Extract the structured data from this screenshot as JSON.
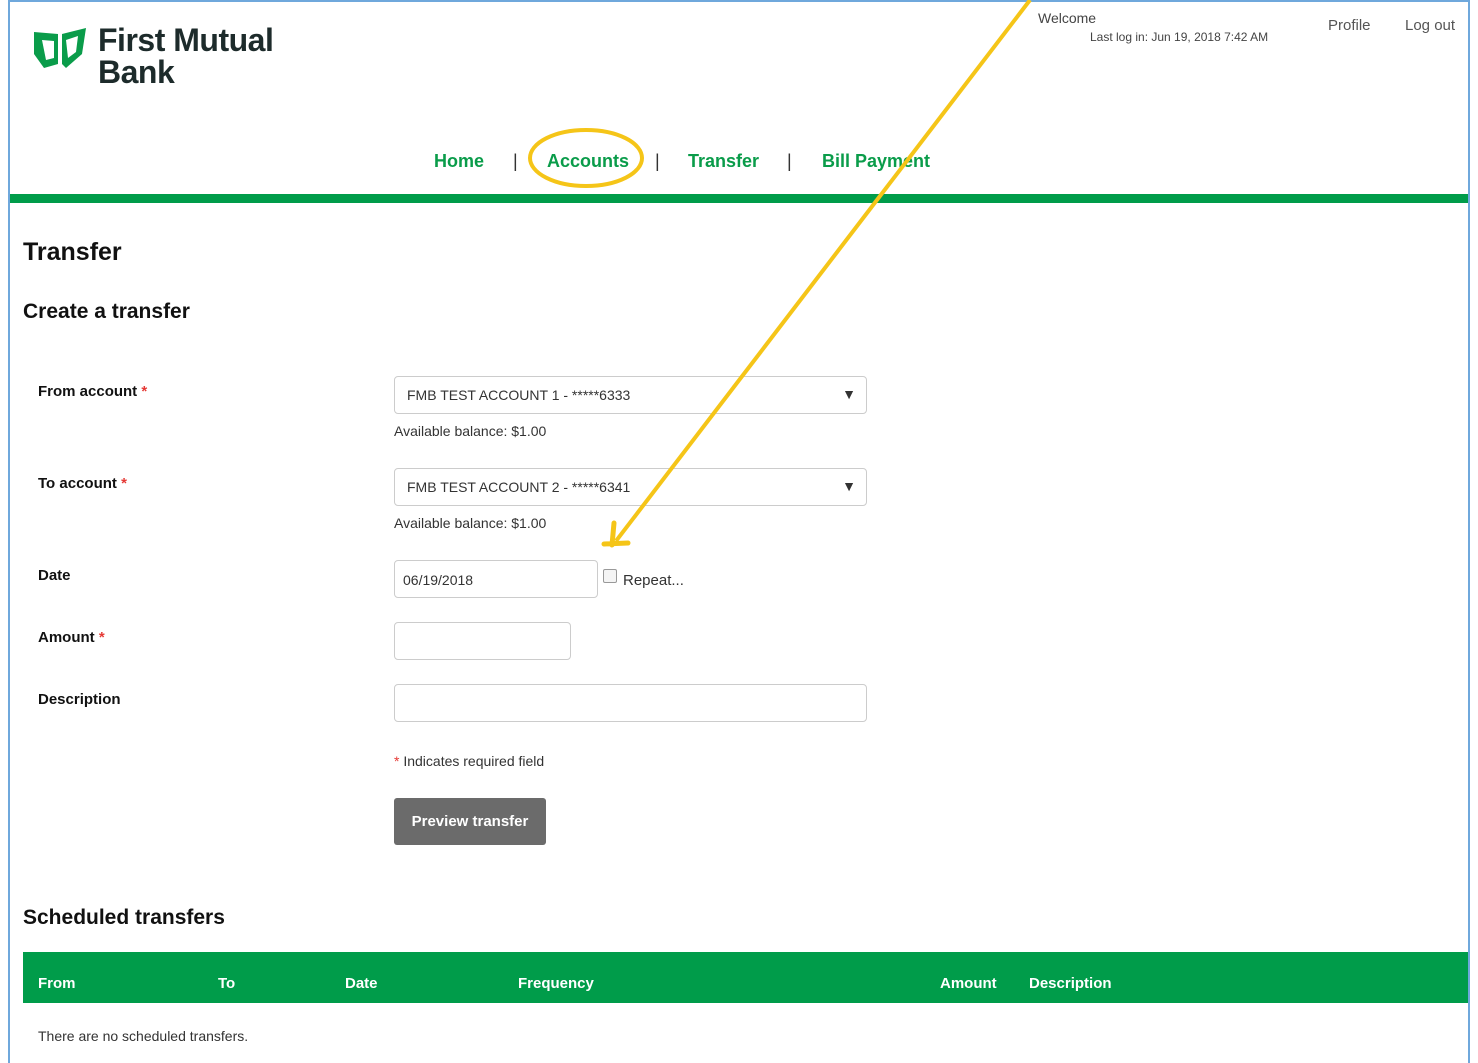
{
  "brand": {
    "name_line1": "First Mutual",
    "name_line2": "Bank",
    "logo_color": "#0a9c4a"
  },
  "header": {
    "welcome": "Welcome",
    "last_login": "Last log in: Jun 19, 2018 7:42 AM",
    "profile": "Profile",
    "logout": "Log out"
  },
  "nav": {
    "items": [
      "Home",
      "Accounts",
      "Transfer",
      "Bill Payment"
    ],
    "separator": "|",
    "accent_color": "#009c4a"
  },
  "page": {
    "title": "Transfer",
    "subtitle": "Create a transfer"
  },
  "form": {
    "from_label": "From account",
    "from_value": "FMB TEST ACCOUNT 1 - *****6333",
    "from_balance": "Available balance: $1.00",
    "to_label": "To account",
    "to_value": "FMB TEST ACCOUNT 2 - *****6341",
    "to_balance": "Available balance: $1.00",
    "date_label": "Date",
    "date_value": "06/19/2018",
    "repeat_label": "Repeat...",
    "amount_label": "Amount",
    "amount_value": "",
    "description_label": "Description",
    "description_value": "",
    "required_marker": "*",
    "required_note": "Indicates required field",
    "submit_label": "Preview transfer",
    "caret": "▼"
  },
  "scheduled": {
    "title": "Scheduled transfers",
    "columns": [
      "From",
      "To",
      "Date",
      "Frequency",
      "Amount",
      "Description"
    ],
    "empty_message": "There are no scheduled transfers."
  },
  "annotation": {
    "color": "#f5c518"
  }
}
